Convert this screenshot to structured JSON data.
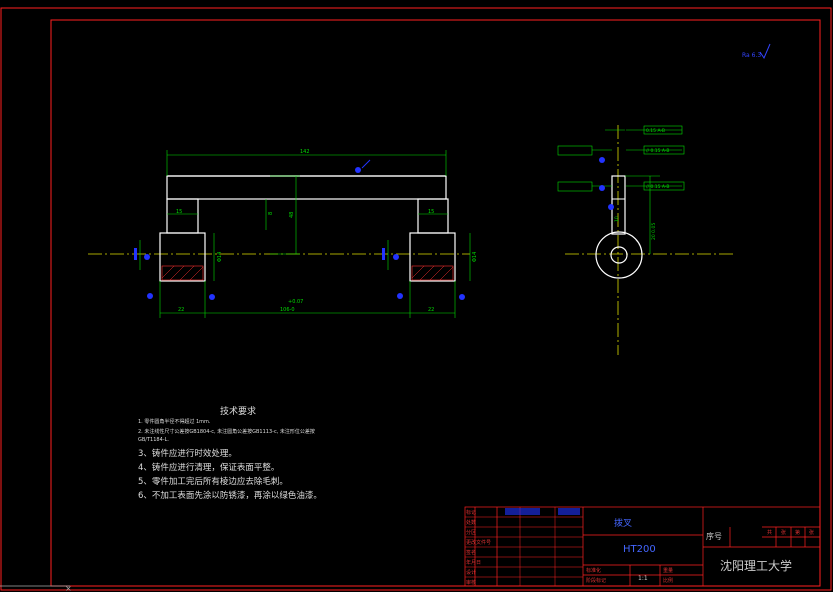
{
  "drawing": {
    "roughness_mark": "Ra 6.3",
    "dimensions": {
      "overall_length": "142",
      "collar_width_left": "15",
      "collar_width_right": "15",
      "boss_width_left": "22",
      "boss_width_right": "22",
      "center_distance": "106-0",
      "center_tol": "+0.07",
      "height_small": "8",
      "height_mid": "48",
      "bore_left": "Φ14",
      "bore_right": "Φ14",
      "side_offset": "10",
      "side_offset2": "20 0.05",
      "gdt_sym": "0.15 A-B",
      "gdt_par1": "// 0.15 A-B",
      "gdt_par2": "// 0.15 A-B"
    }
  },
  "technical_requirements": {
    "title": "技术要求",
    "notes_small": [
      "1. 零件圆角半径不得超过 1mm.",
      "2. 未注线性尺寸公差按GB1804-c, 未注圆角公差按GB1113-c, 未注形位公差按",
      "GB/T1184-L."
    ],
    "notes_large": [
      "3、铸件应进行时效处理。",
      "4、铸件应进行清理，保证表面平整。",
      "5、零件加工完后所有棱边应去除毛刺。",
      "6、不加工表面先涂以防锈漆，再涂以绿色油漆。"
    ]
  },
  "title_block": {
    "part_name": "拨叉",
    "material": "HT200",
    "school": "沈阳理工大学",
    "seq_label": "序号",
    "scale": "1:1",
    "sheet_labels": [
      "共",
      "张",
      "第",
      "张"
    ],
    "row_labels": [
      "标记",
      "处数",
      "分区",
      "更改文件号",
      "签名",
      "年月日"
    ],
    "left_col": [
      "设计",
      "审核",
      "工艺",
      "批准"
    ],
    "mid_labels": [
      "标准化",
      "阶段标记",
      "重量",
      "比例"
    ]
  },
  "colors": {
    "background": "#000000",
    "frame": "#ff0000",
    "outline": "#ffffff",
    "dimension": "#00ff00",
    "centerline": "#ffff00",
    "hatch": "#ff3030",
    "annotation": "#2222ff"
  }
}
